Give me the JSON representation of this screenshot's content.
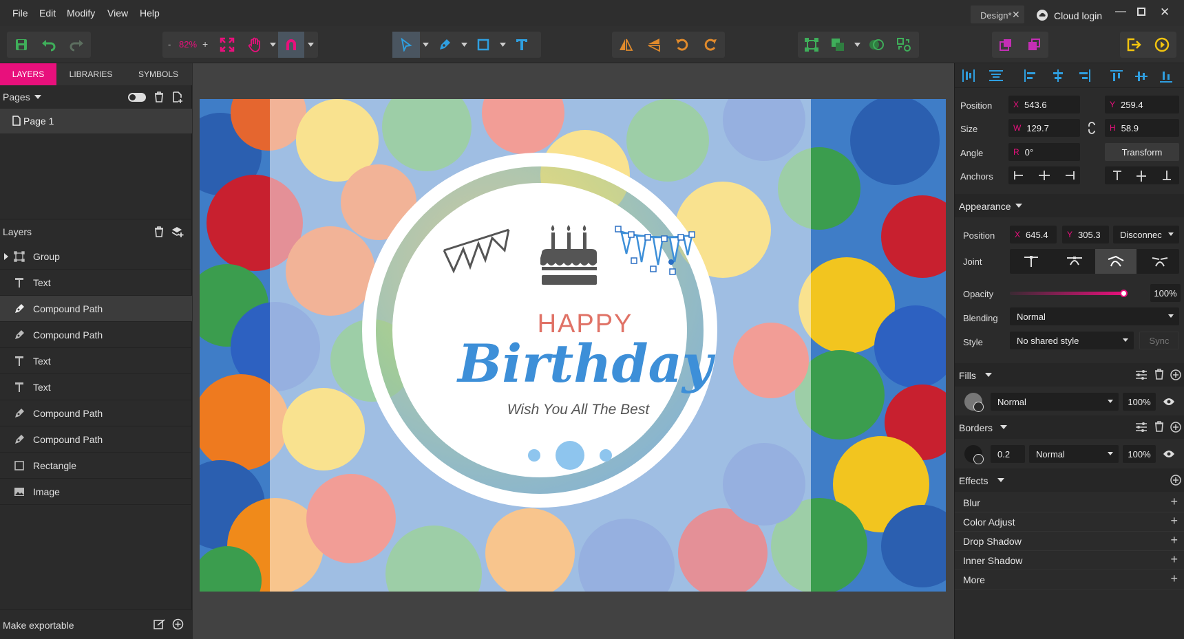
{
  "menu": {
    "items": [
      "File",
      "Edit",
      "Modify",
      "View",
      "Help"
    ]
  },
  "window": {
    "tab_title": "Design*",
    "cloud_login": "Cloud login"
  },
  "toolbar": {
    "zoom_minus": "-",
    "zoom_value": "82%",
    "zoom_plus": "+"
  },
  "left": {
    "tabs": [
      "LAYERS",
      "LIBRARIES",
      "SYMBOLS"
    ],
    "pages_label": "Pages",
    "page_item": "Page 1",
    "layers_label": "Layers",
    "layers": [
      {
        "label": "Group",
        "icon": "group-icon"
      },
      {
        "label": "Text",
        "icon": "text-icon"
      },
      {
        "label": "Compound Path",
        "icon": "path-icon"
      },
      {
        "label": "Compound Path",
        "icon": "path-icon"
      },
      {
        "label": "Text",
        "icon": "text-icon"
      },
      {
        "label": "Text",
        "icon": "text-icon"
      },
      {
        "label": "Compound Path",
        "icon": "path-icon"
      },
      {
        "label": "Compound Path",
        "icon": "path-icon"
      },
      {
        "label": "Rectangle",
        "icon": "rectangle-icon"
      },
      {
        "label": "Image",
        "icon": "image-icon"
      }
    ],
    "selected_layer_index": 2,
    "make_exportable": "Make exportable"
  },
  "canvas": {
    "happy": "HAPPY",
    "birthday": "Birthday",
    "subtitle": "Wish You All The Best",
    "happy_color": "#e07266",
    "birthday_color": "#3d8fd8"
  },
  "right": {
    "geometry": {
      "position_label": "Position",
      "x_axis": "X",
      "x": "543.6",
      "y_axis": "Y",
      "y": "259.4",
      "size_label": "Size",
      "w_axis": "W",
      "w": "129.7",
      "h_axis": "H",
      "h": "58.9",
      "angle_label": "Angle",
      "r_axis": "R",
      "angle": "0°",
      "transform": "Transform",
      "anchors_label": "Anchors"
    },
    "appearance": {
      "title": "Appearance",
      "position_label": "Position",
      "x_axis": "X",
      "x": "645.4",
      "y_axis": "Y",
      "y": "305.3",
      "disconnect": "Disconnec",
      "joint_label": "Joint",
      "opacity_label": "Opacity",
      "opacity": "100%",
      "opacity_level": 1.0,
      "blending_label": "Blending",
      "blending": "Normal",
      "style_label": "Style",
      "style": "No shared style",
      "sync": "Sync"
    },
    "fills": {
      "title": "Fills",
      "mode": "Normal",
      "opacity": "100%"
    },
    "borders": {
      "title": "Borders",
      "width": "0.2",
      "mode": "Normal",
      "opacity": "100%"
    },
    "effects": {
      "title": "Effects",
      "items": [
        "Blur",
        "Color Adjust",
        "Drop Shadow",
        "Inner Shadow",
        "More"
      ]
    }
  },
  "colors": {
    "accent": "#e8107c",
    "panel": "#2b2b2b",
    "canvas_bg": "#424242"
  }
}
